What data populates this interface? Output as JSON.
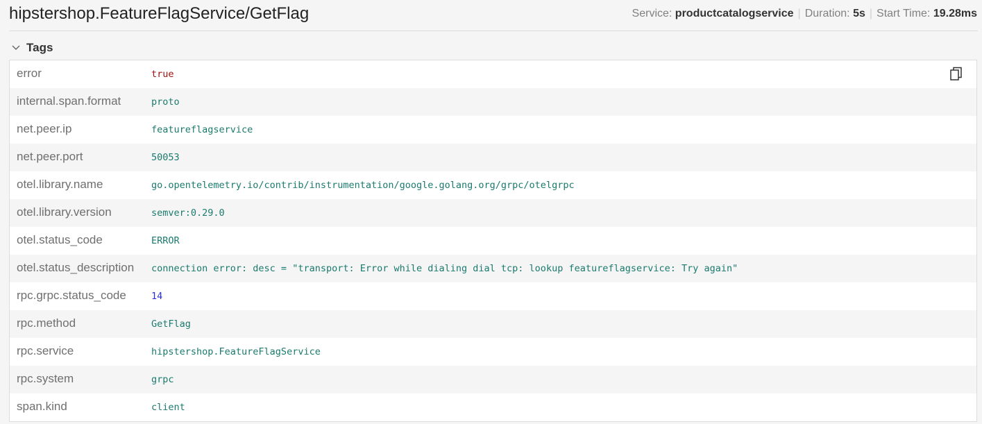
{
  "header": {
    "title": "hipstershop.FeatureFlagService/GetFlag",
    "service_label": "Service:",
    "service_value": "productcatalogservice",
    "duration_label": "Duration:",
    "duration_value": "5s",
    "start_time_label": "Start Time:",
    "start_time_value": "19.28ms"
  },
  "tags_section": {
    "label": "Tags",
    "expanded": true
  },
  "tags": [
    {
      "key": "error",
      "value": "true",
      "type": "bool"
    },
    {
      "key": "internal.span.format",
      "value": "proto",
      "type": "string"
    },
    {
      "key": "net.peer.ip",
      "value": "featureflagservice",
      "type": "string"
    },
    {
      "key": "net.peer.port",
      "value": "50053",
      "type": "string"
    },
    {
      "key": "otel.library.name",
      "value": "go.opentelemetry.io/contrib/instrumentation/google.golang.org/grpc/otelgrpc",
      "type": "string"
    },
    {
      "key": "otel.library.version",
      "value": "semver:0.29.0",
      "type": "string"
    },
    {
      "key": "otel.status_code",
      "value": "ERROR",
      "type": "string"
    },
    {
      "key": "otel.status_description",
      "value": "connection error: desc = \"transport: Error while dialing dial tcp: lookup featureflagservice: Try again\"",
      "type": "string"
    },
    {
      "key": "rpc.grpc.status_code",
      "value": "14",
      "type": "number"
    },
    {
      "key": "rpc.method",
      "value": "GetFlag",
      "type": "string"
    },
    {
      "key": "rpc.service",
      "value": "hipstershop.FeatureFlagService",
      "type": "string"
    },
    {
      "key": "rpc.system",
      "value": "grpc",
      "type": "string"
    },
    {
      "key": "span.kind",
      "value": "client",
      "type": "string"
    }
  ],
  "icons": {
    "chevron": "chevron-down-icon",
    "copy": "copy-icon"
  },
  "colors": {
    "string_value": "#1a7a6e",
    "bool_value": "#a01010",
    "number_value": "#2a2fd6"
  }
}
